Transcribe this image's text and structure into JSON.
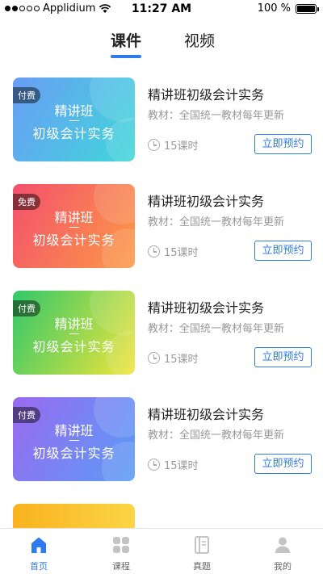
{
  "status_bar": {
    "carrier": "Applidium",
    "time": "11:27 AM",
    "battery": "100 %"
  },
  "tabs": [
    {
      "label": "课件",
      "active": true
    },
    {
      "label": "视频",
      "active": false
    }
  ],
  "courses": [
    {
      "badge": "付费",
      "thumb_line1": "精讲班",
      "thumb_line2": "初级会计实务",
      "title": "精讲班初级会计实务",
      "subtitle": "教材：全国统一教材每年更新",
      "hours": "15课时",
      "button": "立即预约",
      "gradient": [
        "#6a9df5",
        "#3fd7d9"
      ]
    },
    {
      "badge": "免费",
      "thumb_line1": "精讲班",
      "thumb_line2": "初级会计实务",
      "title": "精讲班初级会计实务",
      "subtitle": "教材：全国统一教材每年更新",
      "hours": "15课时",
      "button": "立即预约",
      "gradient": [
        "#f4506e",
        "#fb9a45"
      ]
    },
    {
      "badge": "付费",
      "thumb_line1": "精讲班",
      "thumb_line2": "初级会计实务",
      "title": "精讲班初级会计实务",
      "subtitle": "教材：全国统一教材每年更新",
      "hours": "15课时",
      "button": "立即预约",
      "gradient": [
        "#31c86a",
        "#f1e43a"
      ]
    },
    {
      "badge": "付费",
      "thumb_line1": "精讲班",
      "thumb_line2": "初级会计实务",
      "title": "精讲班初级会计实务",
      "subtitle": "教材：全国统一教材每年更新",
      "hours": "15课时",
      "button": "立即预约",
      "gradient": [
        "#9a6af0",
        "#5a9cf5"
      ]
    }
  ],
  "tab_bar": [
    {
      "label": "首页",
      "icon": "home-icon",
      "active": true
    },
    {
      "label": "课程",
      "icon": "grid-icon",
      "active": false
    },
    {
      "label": "真题",
      "icon": "notebook-icon",
      "active": false
    },
    {
      "label": "我的",
      "icon": "user-icon",
      "active": false
    }
  ],
  "colors": {
    "accent": "#2e7bf0",
    "muted_text": "#999999"
  }
}
